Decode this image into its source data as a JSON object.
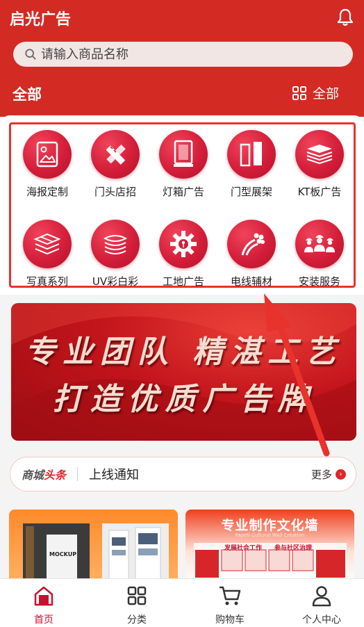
{
  "header": {
    "title": "启光广告",
    "search_placeholder": "请输入商品名称",
    "category_title": "全部",
    "category_all": "全部"
  },
  "categories": [
    {
      "label": "海报定制",
      "icon": "image-icon"
    },
    {
      "label": "门头店招",
      "icon": "pencil-ruler-icon"
    },
    {
      "label": "灯箱广告",
      "icon": "lightbox-icon"
    },
    {
      "label": "门型展架",
      "icon": "door-stand-icon"
    },
    {
      "label": "KT板广告",
      "icon": "board-stack-icon"
    },
    {
      "label": "写真系列",
      "icon": "layers-icon"
    },
    {
      "label": "UV彩白彩",
      "icon": "paper-stack-icon"
    },
    {
      "label": "工地广告",
      "icon": "gear-icon"
    },
    {
      "label": "电线辅材",
      "icon": "cable-icon"
    },
    {
      "label": "安装服务",
      "icon": "workers-icon"
    }
  ],
  "banner": {
    "line1": "专业团队  精湛工艺",
    "line2": "打造优质广告牌"
  },
  "news": {
    "brand_a": "商城",
    "brand_b": "头条",
    "text": "上线通知",
    "more": "更多"
  },
  "cards": {
    "left_mockup_text": "MOCKUP",
    "right_title": "专业制作文化墙",
    "right_subtitle": "Fapeti Cultural Wall Creation",
    "right_board_1": "发展社会工作",
    "right_board_2": "参与社区治理"
  },
  "tabbar": [
    {
      "label": "首页",
      "icon": "home-icon",
      "active": true
    },
    {
      "label": "分类",
      "icon": "grid-icon",
      "active": false
    },
    {
      "label": "购物车",
      "icon": "cart-icon",
      "active": false
    },
    {
      "label": "个人中心",
      "icon": "user-icon",
      "active": false
    }
  ],
  "colors": {
    "brand_red": "#d42a24",
    "accent_red": "#c8102e",
    "grid_border": "#e8322c"
  }
}
